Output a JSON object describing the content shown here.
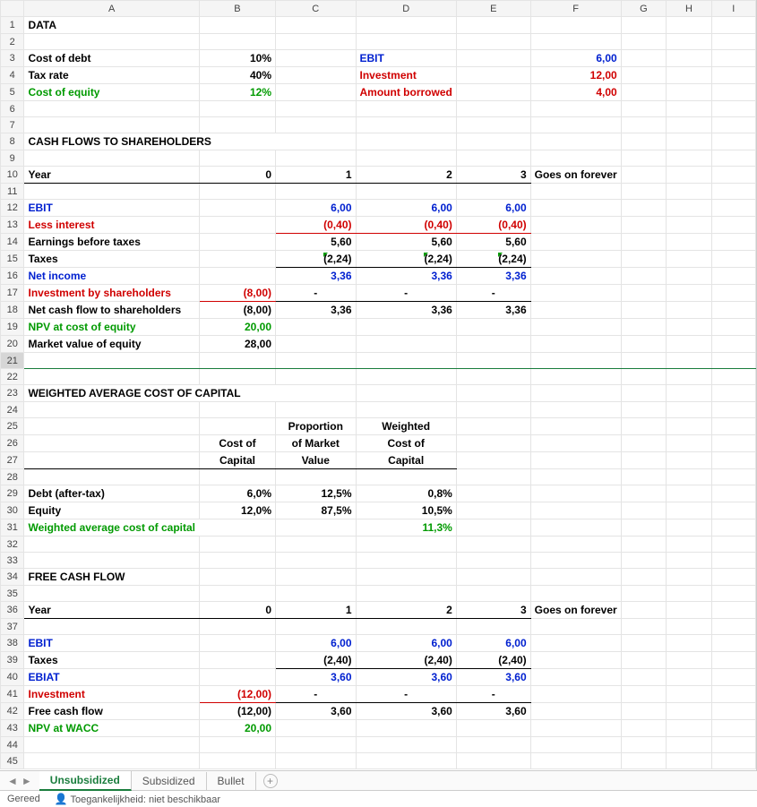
{
  "columns": [
    "A",
    "B",
    "C",
    "D",
    "E",
    "F",
    "G",
    "H",
    "I"
  ],
  "rows": 45,
  "r1": {
    "A": "DATA"
  },
  "r3": {
    "A": "Cost of debt",
    "B": "10%",
    "D": "EBIT",
    "F": "6,00"
  },
  "r4": {
    "A": "Tax rate",
    "B": "40%",
    "D": "Investment",
    "F": "12,00"
  },
  "r5": {
    "A": "Cost of equity",
    "B": "12%",
    "D": "Amount borrowed",
    "F": "4,00"
  },
  "r8": {
    "A": "CASH FLOWS TO SHAREHOLDERS"
  },
  "r10": {
    "A": "Year",
    "B": "0",
    "C": "1",
    "D": "2",
    "E": "3",
    "F": "Goes on forever"
  },
  "r12": {
    "A": "EBIT",
    "C": "6,00",
    "D": "6,00",
    "E": "6,00"
  },
  "r13": {
    "A": "Less interest",
    "C": "(0,40)",
    "D": "(0,40)",
    "E": "(0,40)"
  },
  "r14": {
    "A": "Earnings before taxes",
    "C": "5,60",
    "D": "5,60",
    "E": "5,60"
  },
  "r15": {
    "A": "Taxes",
    "C": "(2,24)",
    "D": "(2,24)",
    "E": "(2,24)"
  },
  "r16": {
    "A": "Net income",
    "C": "3,36",
    "D": "3,36",
    "E": "3,36"
  },
  "r17": {
    "A": "Investment by shareholders",
    "B": "(8,00)",
    "C": "-",
    "D": "-",
    "E": "-"
  },
  "r18": {
    "A": "Net cash flow to shareholders",
    "B": "(8,00)",
    "C": "3,36",
    "D": "3,36",
    "E": "3,36"
  },
  "r19": {
    "A": "NPV at cost of equity",
    "B": "20,00"
  },
  "r20": {
    "A": "Market value of equity",
    "B": "28,00"
  },
  "r23": {
    "A": "WEIGHTED AVERAGE COST OF CAPITAL"
  },
  "r25": {
    "C": "Proportion",
    "D": "Weighted"
  },
  "r26": {
    "B": "Cost of",
    "C": "of Market",
    "D": "Cost of"
  },
  "r27": {
    "B": "Capital",
    "C": "Value",
    "D": "Capital"
  },
  "r29": {
    "A": "Debt (after-tax)",
    "B": "6,0%",
    "C": "12,5%",
    "D": "0,8%"
  },
  "r30": {
    "A": "Equity",
    "B": "12,0%",
    "C": "87,5%",
    "D": "10,5%"
  },
  "r31": {
    "A": "Weighted average cost of capital",
    "D": "11,3%"
  },
  "r34": {
    "A": "FREE CASH FLOW"
  },
  "r36": {
    "A": "Year",
    "B": "0",
    "C": "1",
    "D": "2",
    "E": "3",
    "F": "Goes on forever"
  },
  "r38": {
    "A": "EBIT",
    "C": "6,00",
    "D": "6,00",
    "E": "6,00"
  },
  "r39": {
    "A": "Taxes",
    "C": "(2,40)",
    "D": "(2,40)",
    "E": "(2,40)"
  },
  "r40": {
    "A": "EBIAT",
    "C": "3,60",
    "D": "3,60",
    "E": "3,60"
  },
  "r41": {
    "A": "Investment",
    "B": "(12,00)",
    "C": "-",
    "D": "-",
    "E": "-"
  },
  "r42": {
    "A": "Free cash flow",
    "B": "(12,00)",
    "C": "3,60",
    "D": "3,60",
    "E": "3,60"
  },
  "r43": {
    "A": "NPV at WACC",
    "B": "20,00"
  },
  "tabs": {
    "t1": "Unsubsidized",
    "t2": "Subsidized",
    "t3": "Bullet"
  },
  "status": {
    "ready": "Gereed",
    "acc": "Toegankelijkheid: niet beschikbaar"
  }
}
